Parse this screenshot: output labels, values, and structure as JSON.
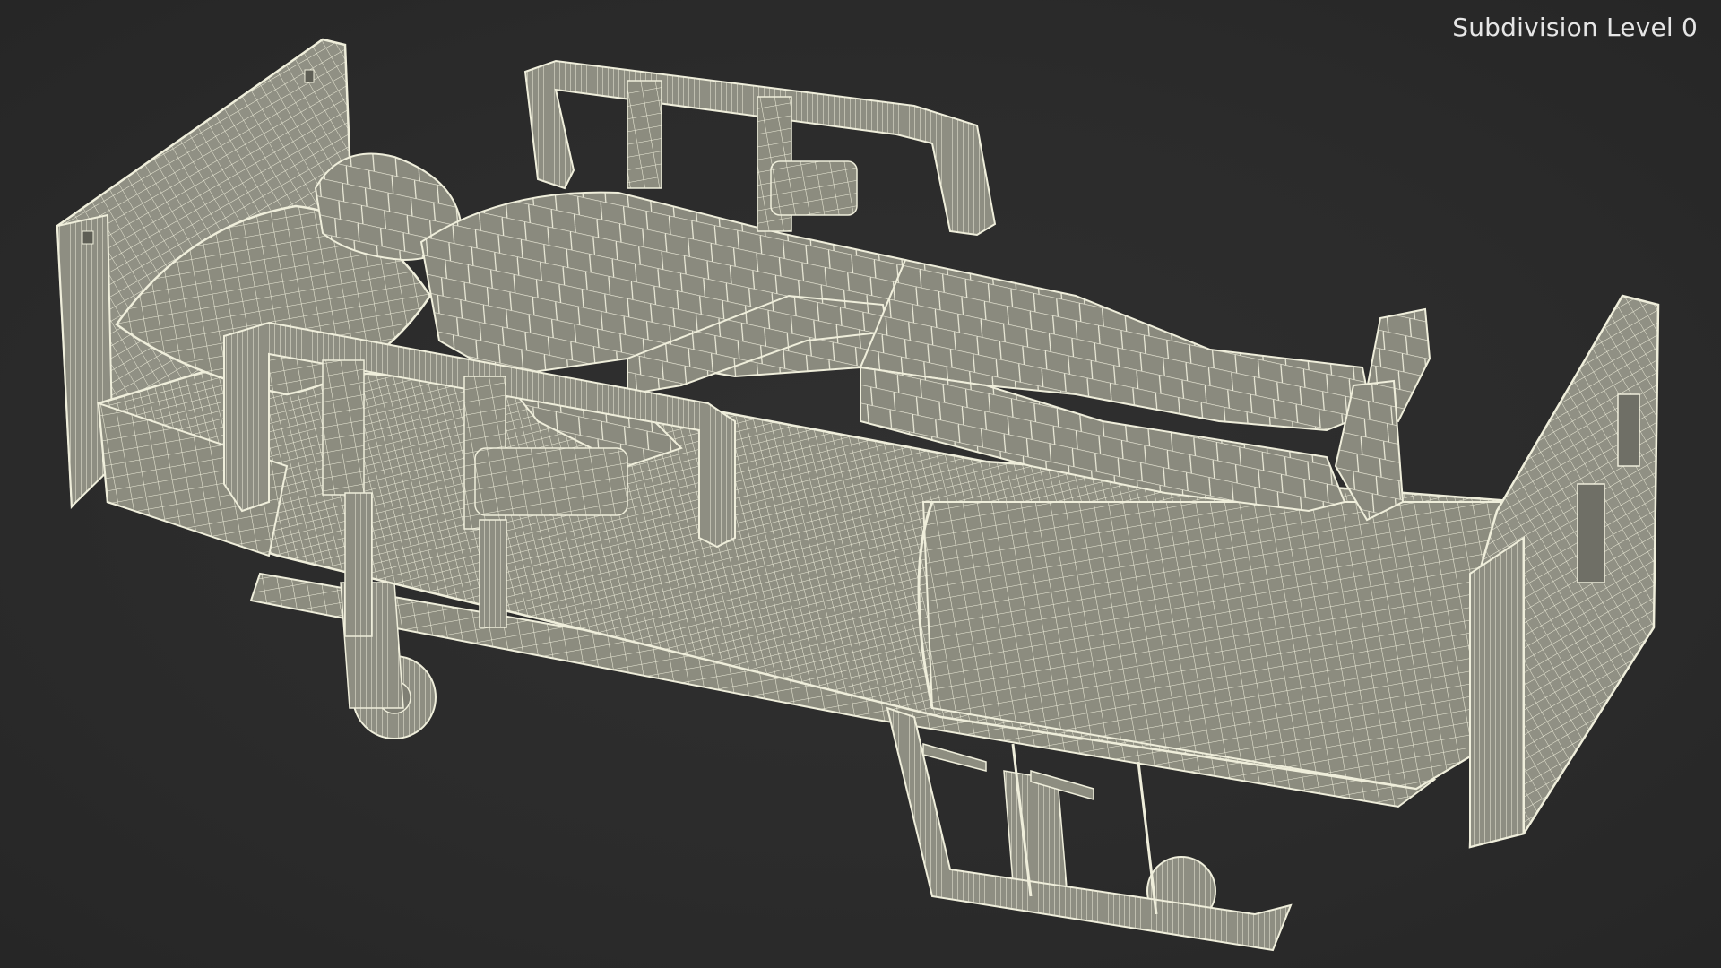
{
  "viewport": {
    "label": "Subdivision Level 0",
    "background_color": "#2c2c2c",
    "mesh_fill_color": "#9a9a8c",
    "wire_color": "#f2f0dc",
    "subject": "hospital-bed-with-patient-wireframe"
  }
}
